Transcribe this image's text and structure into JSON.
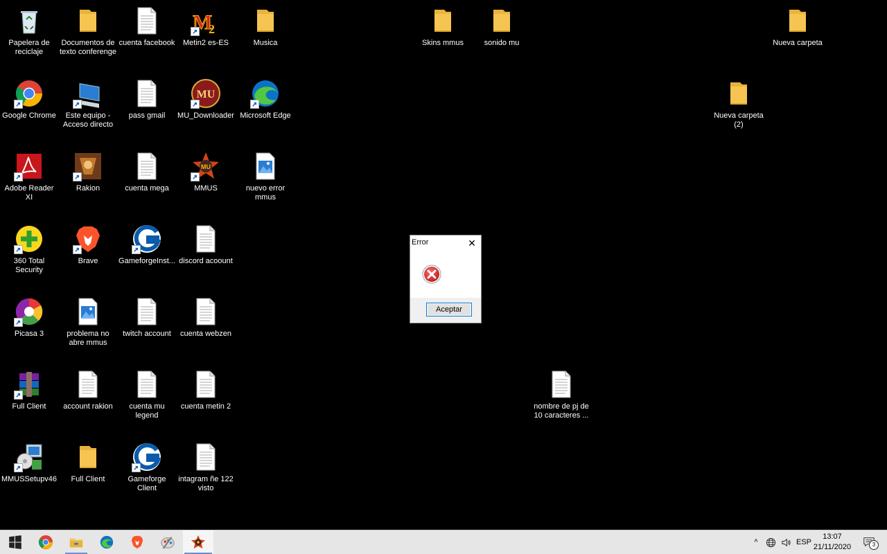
{
  "desktop": {
    "icons": [
      {
        "label": "Papelera de reciclaje",
        "type": "recycle-bin"
      },
      {
        "label": "Documentos de texto conferenge",
        "type": "folder"
      },
      {
        "label": "cuenta facebook",
        "type": "text-file"
      },
      {
        "label": "Metin2 es-ES",
        "type": "metin2"
      },
      {
        "label": "Musica",
        "type": "folder"
      },
      {
        "label": "Skins mmus",
        "type": "folder"
      },
      {
        "label": "sonido mu",
        "type": "folder"
      },
      {
        "label": "Nueva carpeta",
        "type": "folder"
      },
      {
        "label": "Google Chrome",
        "type": "chrome"
      },
      {
        "label": "Este equipo - Acceso directo",
        "type": "computer"
      },
      {
        "label": "pass gmail",
        "type": "text-file"
      },
      {
        "label": "MU_Downloader",
        "type": "mu-downloader"
      },
      {
        "label": "Microsoft Edge",
        "type": "edge"
      },
      {
        "label": "Nueva carpeta (2)",
        "type": "folder"
      },
      {
        "label": "Adobe Reader XI",
        "type": "adobe"
      },
      {
        "label": "Rakion",
        "type": "rakion"
      },
      {
        "label": "cuenta mega",
        "type": "text-file"
      },
      {
        "label": "MMUS",
        "type": "mmus"
      },
      {
        "label": "nuevo error mmus",
        "type": "image-file"
      },
      {
        "label": "360 Total Security",
        "type": "security360"
      },
      {
        "label": "Brave",
        "type": "brave"
      },
      {
        "label": "GameforgeInst...",
        "type": "gameforge"
      },
      {
        "label": "discord acoount",
        "type": "text-file"
      },
      {
        "label": "Picasa 3",
        "type": "picasa"
      },
      {
        "label": "problema no abre mmus",
        "type": "image-file"
      },
      {
        "label": "twitch account",
        "type": "text-file"
      },
      {
        "label": "cuenta webzen",
        "type": "text-file"
      },
      {
        "label": "Full Client",
        "type": "winrar"
      },
      {
        "label": "account rakion",
        "type": "text-file"
      },
      {
        "label": "cuenta mu legend",
        "type": "text-file"
      },
      {
        "label": "cuenta metin 2",
        "type": "text-file"
      },
      {
        "label": "nombre de pj de 10 caracteres ...",
        "type": "text-file"
      },
      {
        "label": "MMUSSetupv46",
        "type": "installer"
      },
      {
        "label": "Full Client",
        "type": "folder"
      },
      {
        "label": "Gameforge Client",
        "type": "gameforge"
      },
      {
        "label": "intagram ñe 122 visto",
        "type": "text-file"
      }
    ]
  },
  "dialog": {
    "title": "Error",
    "close_glyph": "✕",
    "ok_label": "Aceptar"
  },
  "taskbar": {
    "language": "ESP",
    "time": "13:07",
    "date": "21/11/2020",
    "notification_count": "3",
    "tray_chevron": "^"
  },
  "colors": {
    "desktop_bg": "#000000",
    "taskbar_bg": "#e6e6e6",
    "folder": "#f5c451",
    "accent": "#0078d7",
    "error_red": "#d32f2f"
  }
}
